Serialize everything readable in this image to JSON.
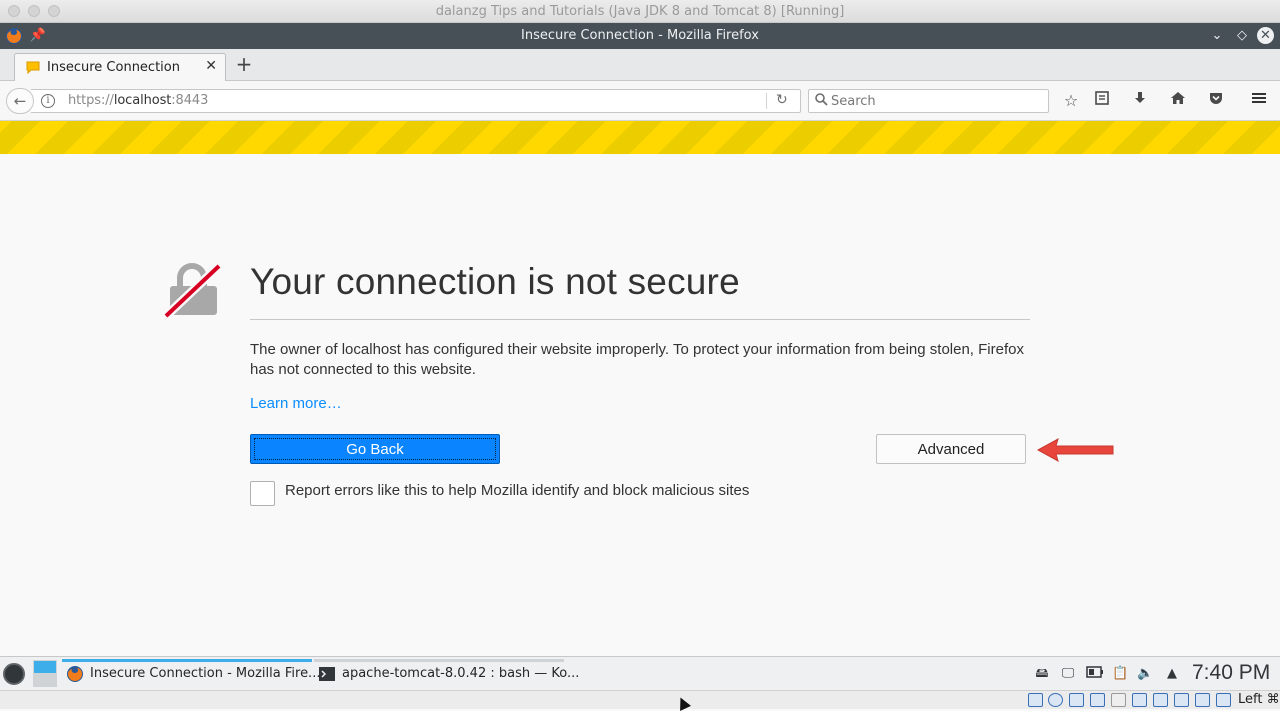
{
  "vbox": {
    "title": "dalanzg Tips and Tutorials (Java JDK 8 and Tomcat 8) [Running]",
    "status_hostkey": "Left ⌘"
  },
  "window": {
    "title": "Insecure Connection - Mozilla Firefox",
    "buttons": [
      "chevron-down-icon",
      "diamond-icon",
      "close-icon"
    ]
  },
  "tabs": [
    {
      "label": "Insecure Connection",
      "active": true
    }
  ],
  "navbar": {
    "url_scheme": "https://",
    "url_host": "localhost",
    "url_port": ":8443",
    "search_placeholder": "Search"
  },
  "error_page": {
    "title": "Your connection is not secure",
    "description": "The owner of localhost has configured their website improperly. To protect your information from being stolen, Firefox has not connected to this website.",
    "learn_more": "Learn more…",
    "go_back": "Go Back",
    "advanced": "Advanced",
    "report_label": "Report errors like this to help Mozilla identify and block malicious sites",
    "report_checked": false
  },
  "taskbar": {
    "tasks": [
      {
        "label": "Insecure Connection - Mozilla Fire...",
        "active": true
      },
      {
        "label": "apache-tomcat-8.0.42 : bash — Ko...",
        "active": false
      }
    ],
    "clock": "7:40 PM"
  },
  "colors": {
    "accent_blue": "#0a84ff",
    "warning_yellow": "#ffd800",
    "annotation_arrow": "#e8463c",
    "titlebar": "#475057"
  }
}
